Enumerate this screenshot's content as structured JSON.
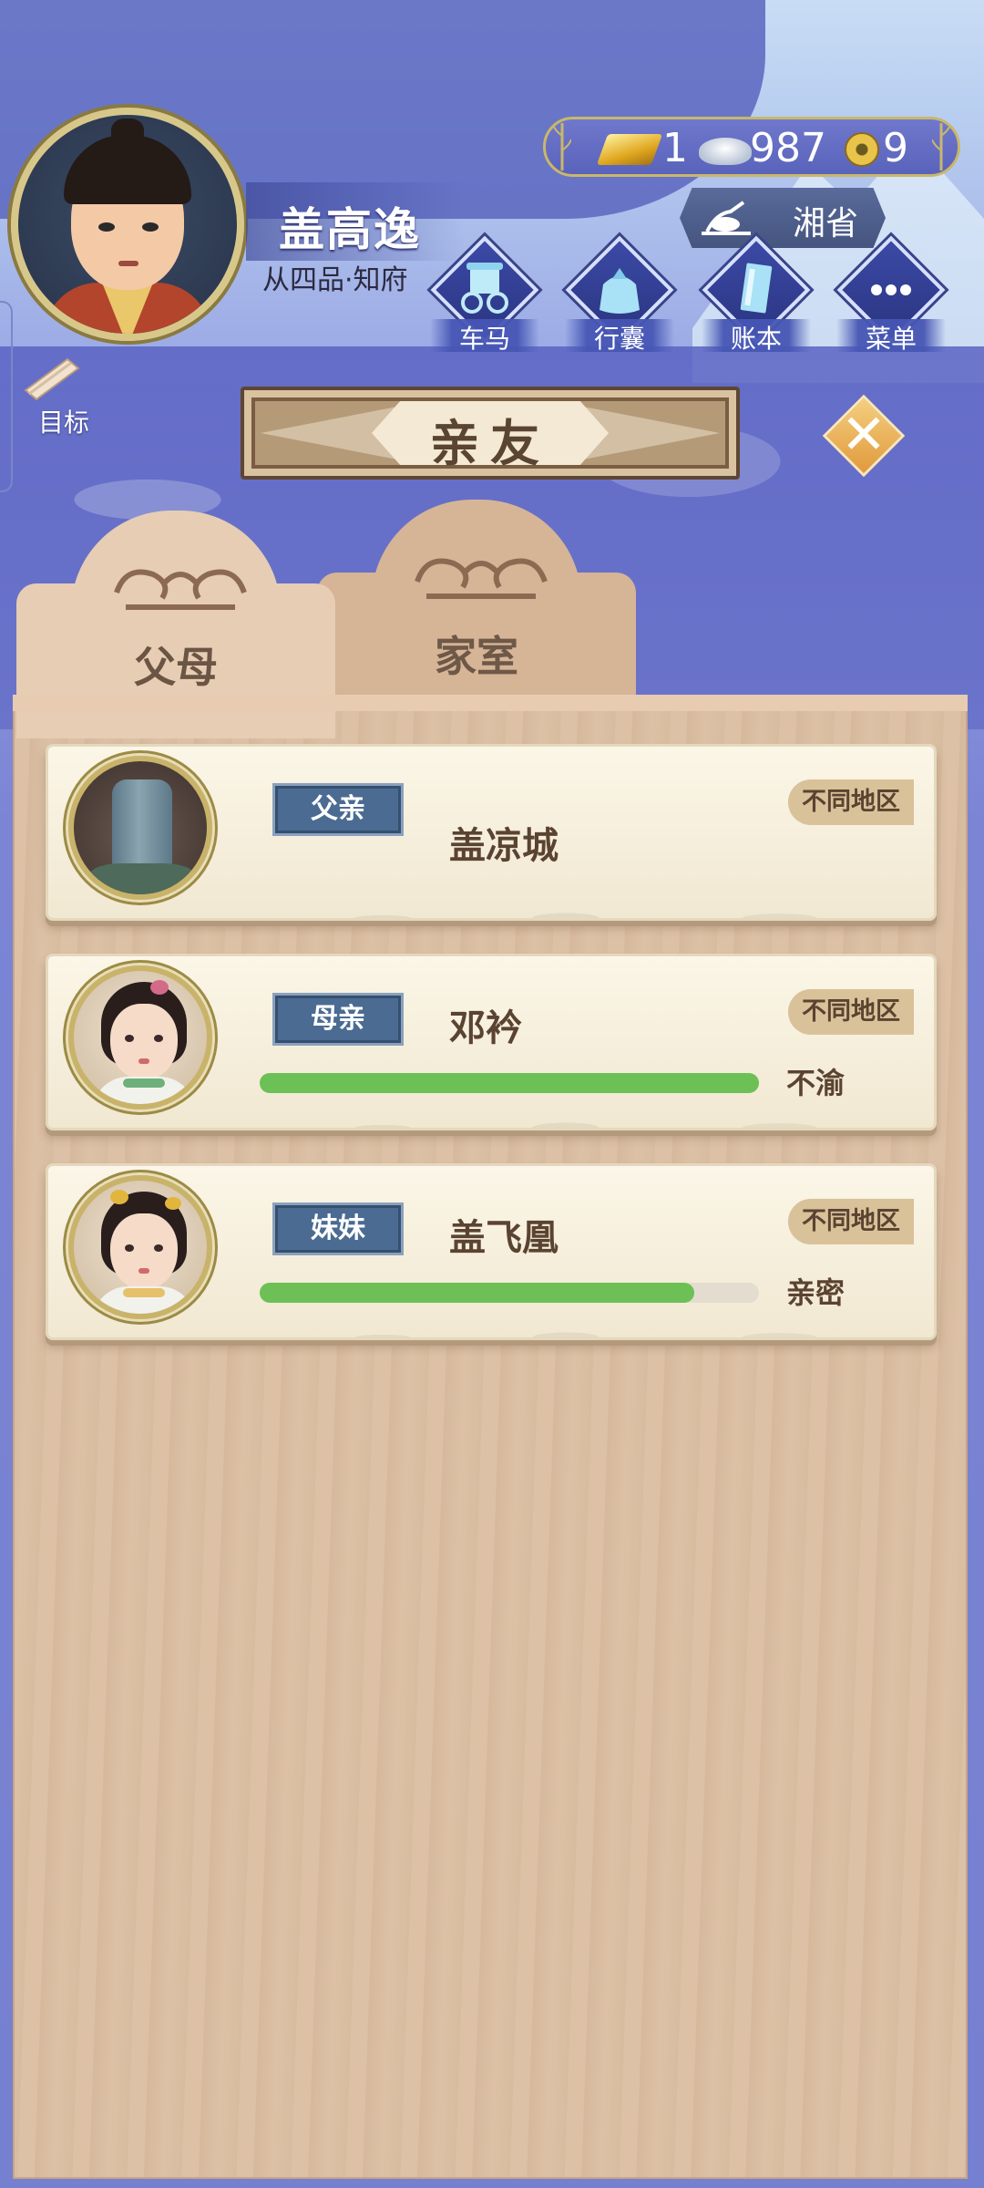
{
  "player": {
    "name": "盖高逸",
    "rank": "从四品·知府"
  },
  "currency": {
    "gold": "1",
    "silver": "987",
    "coins": "9"
  },
  "region": {
    "label": "湘省"
  },
  "menu": [
    {
      "label": "车马",
      "icon": "carriage-icon"
    },
    {
      "label": "行囊",
      "icon": "bag-icon"
    },
    {
      "label": "账本",
      "icon": "ledger-icon"
    },
    {
      "label": "菜单",
      "icon": "more-icon"
    }
  ],
  "goal": {
    "label": "目标"
  },
  "title": "亲友",
  "tabs": [
    {
      "label": "父母",
      "active": true
    },
    {
      "label": "家室",
      "active": false
    }
  ],
  "relatives": [
    {
      "role": "父亲",
      "name": "盖凉城",
      "region": "不同地区",
      "relation": "",
      "affinity": null
    },
    {
      "role": "母亲",
      "name": "邓衿",
      "region": "不同地区",
      "relation": "不渝",
      "affinity": 1.0
    },
    {
      "role": "妹妹",
      "name": "盖飞凰",
      "region": "不同地区",
      "relation": "亲密",
      "affinity": 0.87
    }
  ],
  "colors": {
    "affinity_bar": "#6cc055",
    "role_badge": "#4b6b92",
    "panel_wood": "#dcc1a6"
  }
}
